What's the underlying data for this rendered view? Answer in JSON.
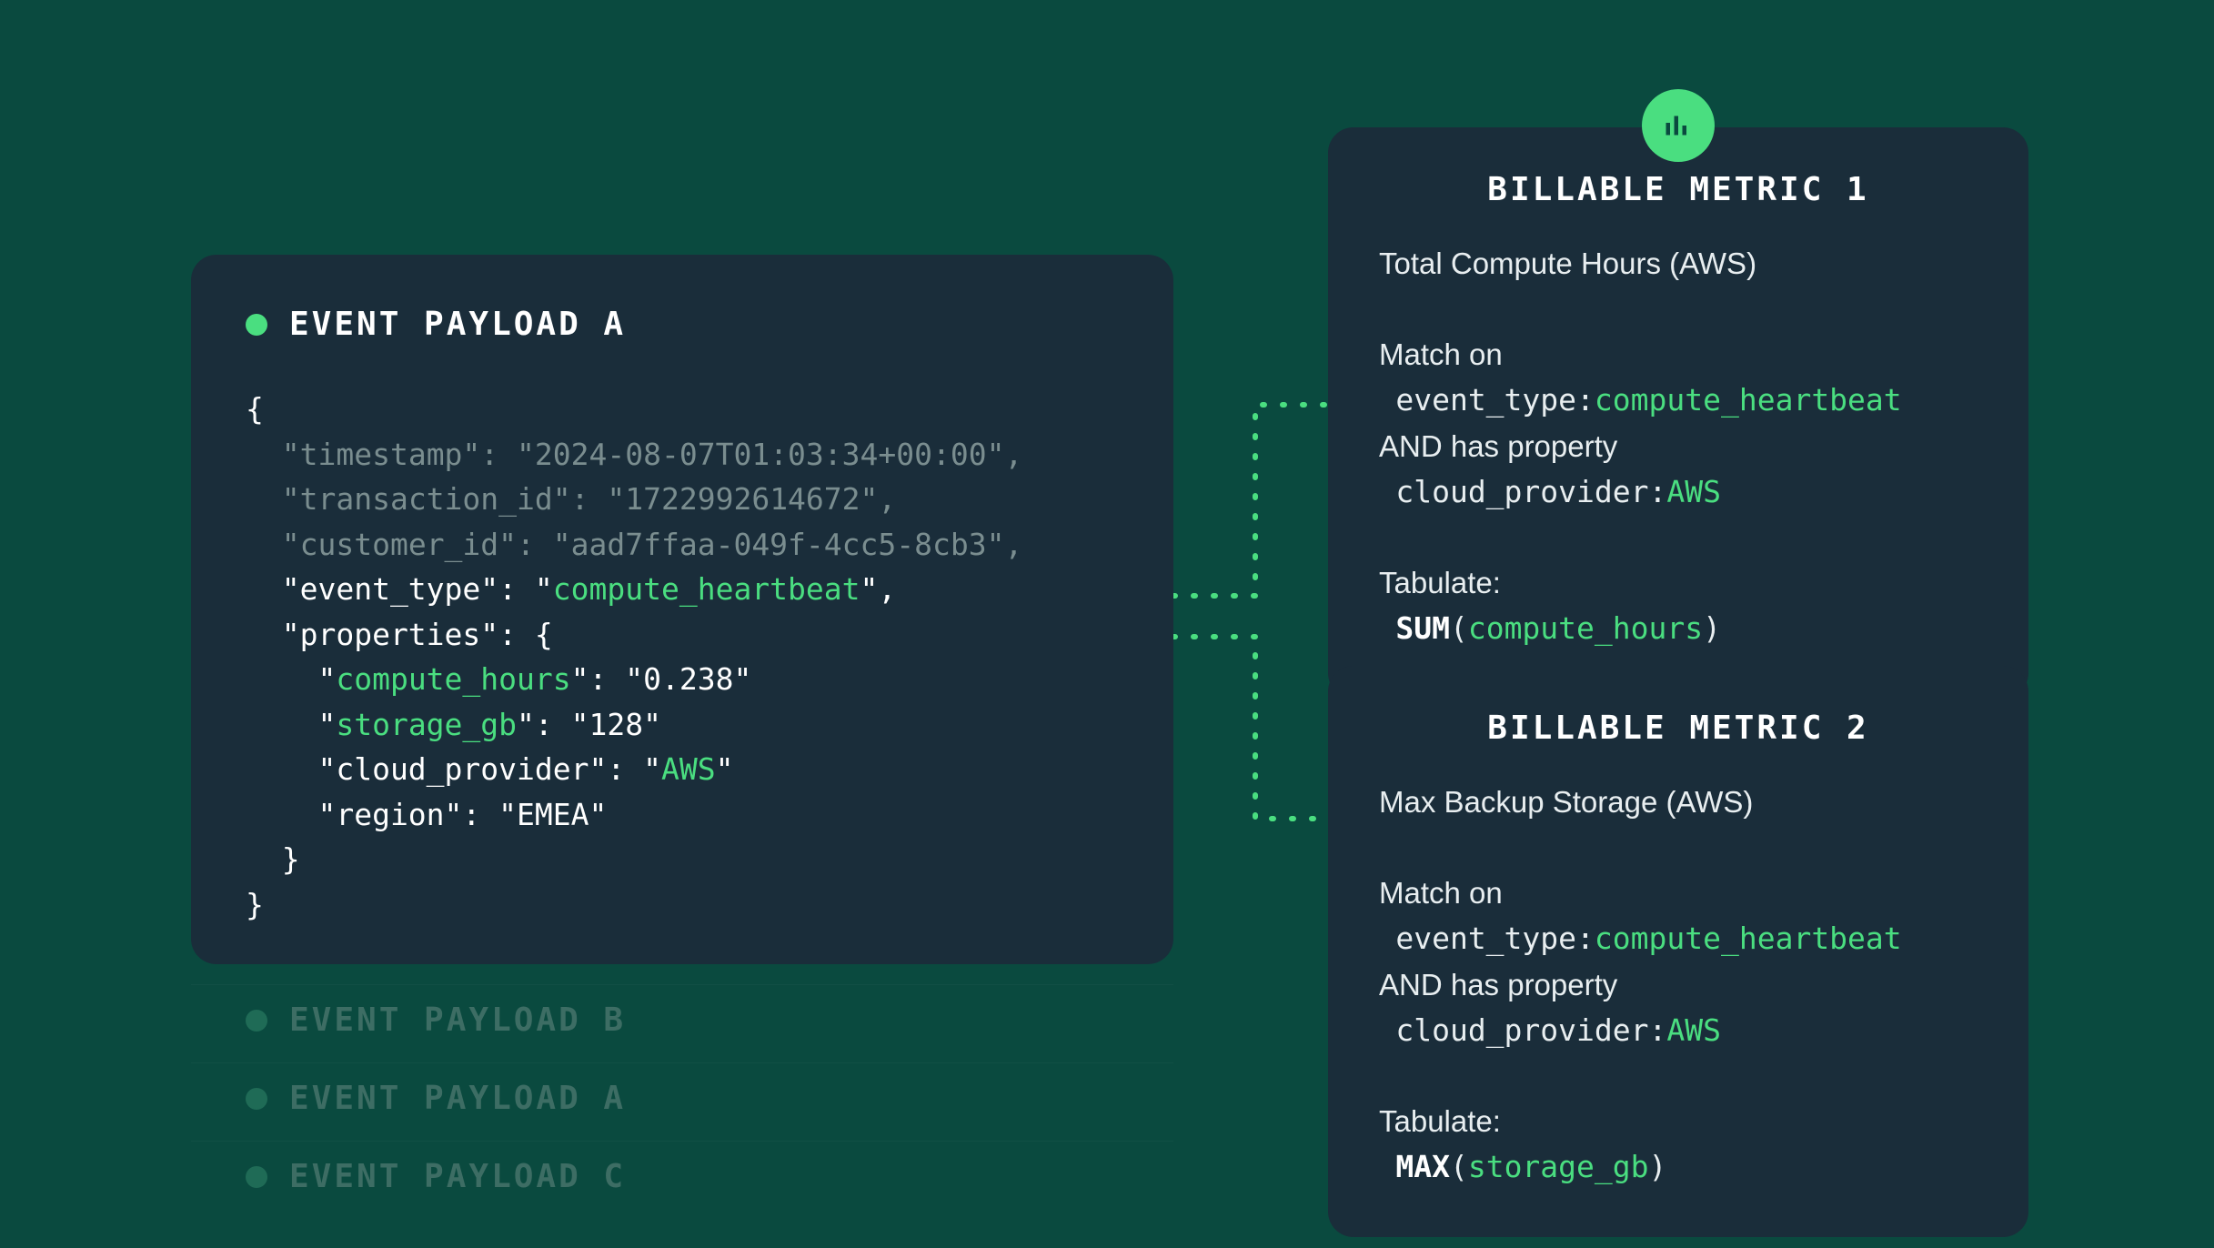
{
  "payload": {
    "title": "EVENT PAYLOAD A",
    "json": {
      "timestamp": "2024-08-07T01:03:34+00:00",
      "transaction_id": "1722992614672",
      "customer_id": "aad7ffaa-049f-4cc5-8cb3",
      "event_type": "compute_heartbeat",
      "properties": {
        "compute_hours": "0.238",
        "storage_gb": "128",
        "cloud_provider": "AWS",
        "region": "EMEA"
      }
    }
  },
  "ghosts": [
    {
      "label": "EVENT PAYLOAD B"
    },
    {
      "label": "EVENT PAYLOAD A"
    },
    {
      "label": "EVENT PAYLOAD C"
    }
  ],
  "metrics": [
    {
      "heading": "BILLABLE METRIC 1",
      "name": "Total Compute Hours (AWS)",
      "match_label": "Match on",
      "match_key": "event_type",
      "match_value": "compute_heartbeat",
      "and_label": "AND has property",
      "prop_key": "cloud_provider",
      "prop_value": "AWS",
      "tabulate_label": "Tabulate:",
      "agg": "SUM",
      "agg_field": "compute_hours"
    },
    {
      "heading": "BILLABLE METRIC 2",
      "name": "Max Backup Storage (AWS)",
      "match_label": "Match on",
      "match_key": "event_type",
      "match_value": "compute_heartbeat",
      "and_label": "AND has property",
      "prop_key": "cloud_provider",
      "prop_value": "AWS",
      "tabulate_label": "Tabulate:",
      "agg": "MAX",
      "agg_field": "storage_gb"
    }
  ],
  "colors": {
    "bg": "#0a4a3f",
    "card": "#1a2d3a",
    "accent": "#4ade80",
    "muted": "#7a8d8f"
  }
}
